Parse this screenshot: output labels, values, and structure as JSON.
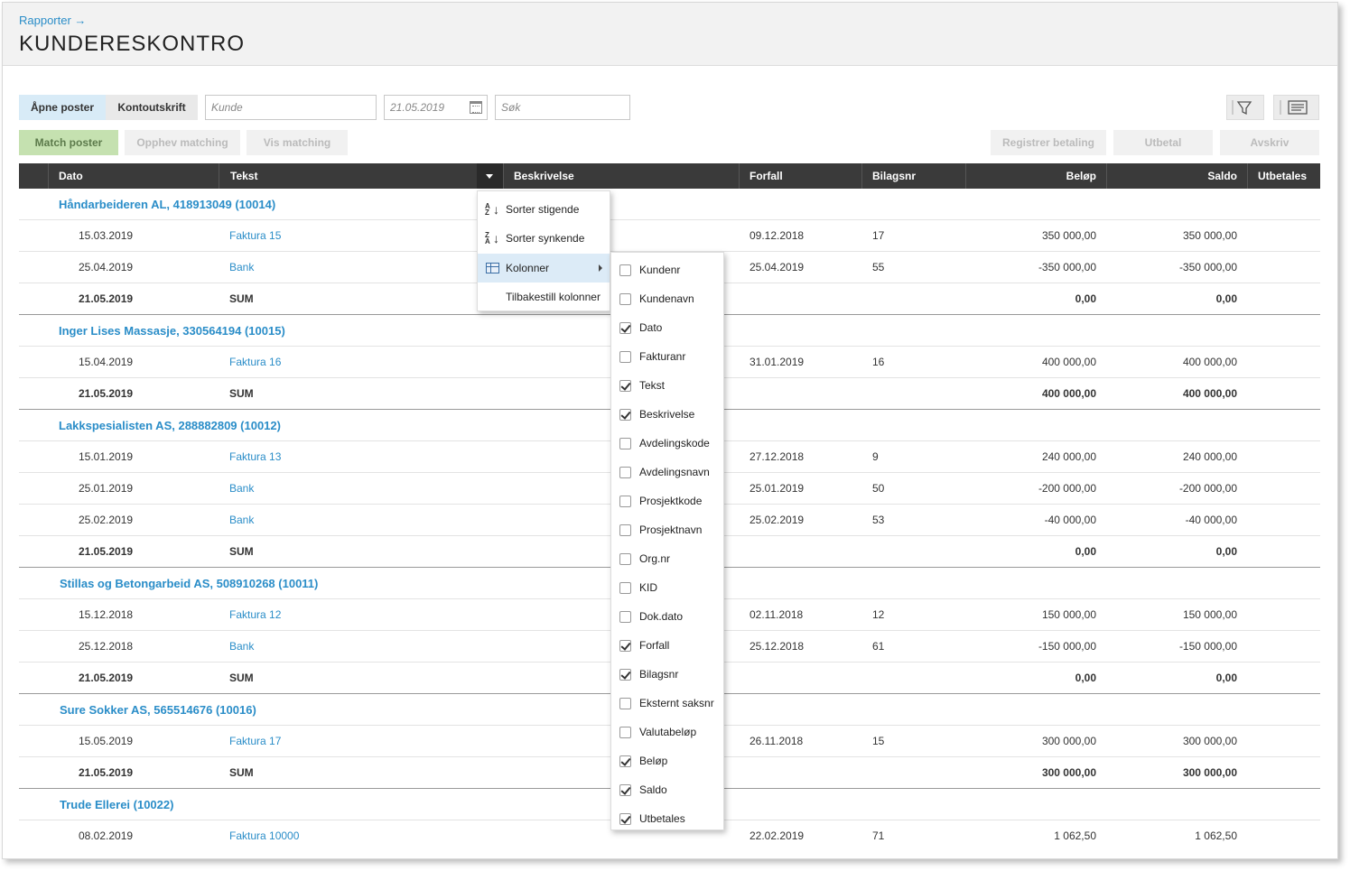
{
  "header": {
    "breadcrumb": "Rapporter →",
    "title": "KUNDERESKONTRO"
  },
  "toolbar": {
    "tab_open": "Åpne poster",
    "tab_statement": "Kontoutskrift",
    "customer_placeholder": "Kunde",
    "date_value": "21.05.2019",
    "search_placeholder": "Søk",
    "match_label": "Match poster",
    "unmatch_label": "Opphev matching",
    "show_matching_label": "Vis matching",
    "register_payment_label": "Registrer betaling",
    "payout_label": "Utbetal",
    "writeoff_label": "Avskriv"
  },
  "columns": {
    "dato": "Dato",
    "tekst": "Tekst",
    "beskrivelse": "Beskrivelse",
    "forfall": "Forfall",
    "bilagsnr": "Bilagsnr",
    "belop": "Beløp",
    "saldo": "Saldo",
    "utbetales": "Utbetales"
  },
  "groups": [
    {
      "title": "Håndarbeideren AL, 418913049 (10014)",
      "rows": [
        {
          "dato": "15.03.2019",
          "tekst": "Faktura 15",
          "forfall": "09.12.2018",
          "bilagsnr": "17",
          "belop": "350 000,00",
          "saldo": "350 000,00"
        },
        {
          "dato": "25.04.2019",
          "tekst": "Bank",
          "forfall": "25.04.2019",
          "bilagsnr": "55",
          "belop": "-350 000,00",
          "saldo": "-350 000,00"
        }
      ],
      "sum": {
        "dato": "21.05.2019",
        "tekst": "SUM",
        "belop": "0,00",
        "saldo": "0,00"
      }
    },
    {
      "title": "Inger Lises Massasje, 330564194 (10015)",
      "rows": [
        {
          "dato": "15.04.2019",
          "tekst": "Faktura 16",
          "forfall": "31.01.2019",
          "bilagsnr": "16",
          "belop": "400 000,00",
          "saldo": "400 000,00"
        }
      ],
      "sum": {
        "dato": "21.05.2019",
        "tekst": "SUM",
        "belop": "400 000,00",
        "saldo": "400 000,00"
      }
    },
    {
      "title": "Lakkspesialisten AS, 288882809 (10012)",
      "rows": [
        {
          "dato": "15.01.2019",
          "tekst": "Faktura 13",
          "forfall": "27.12.2018",
          "bilagsnr": "9",
          "belop": "240 000,00",
          "saldo": "240 000,00"
        },
        {
          "dato": "25.01.2019",
          "tekst": "Bank",
          "forfall": "25.01.2019",
          "bilagsnr": "50",
          "belop": "-200 000,00",
          "saldo": "-200 000,00"
        },
        {
          "dato": "25.02.2019",
          "tekst": "Bank",
          "forfall": "25.02.2019",
          "bilagsnr": "53",
          "belop": "-40 000,00",
          "saldo": "-40 000,00"
        }
      ],
      "sum": {
        "dato": "21.05.2019",
        "tekst": "SUM",
        "belop": "0,00",
        "saldo": "0,00"
      }
    },
    {
      "title": "Stillas og Betongarbeid AS, 508910268 (10011)",
      "rows": [
        {
          "dato": "15.12.2018",
          "tekst": "Faktura 12",
          "forfall": "02.11.2018",
          "bilagsnr": "12",
          "belop": "150 000,00",
          "saldo": "150 000,00"
        },
        {
          "dato": "25.12.2018",
          "tekst": "Bank",
          "forfall": "25.12.2018",
          "bilagsnr": "61",
          "belop": "-150 000,00",
          "saldo": "-150 000,00"
        }
      ],
      "sum": {
        "dato": "21.05.2019",
        "tekst": "SUM",
        "belop": "0,00",
        "saldo": "0,00"
      }
    },
    {
      "title": "Sure Sokker AS, 565514676 (10016)",
      "rows": [
        {
          "dato": "15.05.2019",
          "tekst": "Faktura 17",
          "forfall": "26.11.2018",
          "bilagsnr": "15",
          "belop": "300 000,00",
          "saldo": "300 000,00"
        }
      ],
      "sum": {
        "dato": "21.05.2019",
        "tekst": "SUM",
        "belop": "300 000,00",
        "saldo": "300 000,00"
      }
    },
    {
      "title": "Trude Ellerei (10022)",
      "rows": [
        {
          "dato": "08.02.2019",
          "tekst": "Faktura 10000",
          "forfall": "22.02.2019",
          "bilagsnr": "71",
          "belop": "1 062,50",
          "saldo": "1 062,50"
        }
      ]
    }
  ],
  "context_menu": {
    "sort_asc": "Sorter stigende",
    "sort_desc": "Sorter synkende",
    "columns": "Kolonner",
    "reset_columns": "Tilbakestill kolonner"
  },
  "column_options": [
    {
      "label": "Kundenr",
      "checked": false
    },
    {
      "label": "Kundenavn",
      "checked": false
    },
    {
      "label": "Dato",
      "checked": true
    },
    {
      "label": "Fakturanr",
      "checked": false
    },
    {
      "label": "Tekst",
      "checked": true
    },
    {
      "label": "Beskrivelse",
      "checked": true
    },
    {
      "label": "Avdelingskode",
      "checked": false
    },
    {
      "label": "Avdelingsnavn",
      "checked": false
    },
    {
      "label": "Prosjektkode",
      "checked": false
    },
    {
      "label": "Prosjektnavn",
      "checked": false
    },
    {
      "label": "Org.nr",
      "checked": false
    },
    {
      "label": "KID",
      "checked": false
    },
    {
      "label": "Dok.dato",
      "checked": false
    },
    {
      "label": "Forfall",
      "checked": true
    },
    {
      "label": "Bilagsnr",
      "checked": true
    },
    {
      "label": "Eksternt saksnr",
      "checked": false
    },
    {
      "label": "Valutabeløp",
      "checked": false
    },
    {
      "label": "Beløp",
      "checked": true
    },
    {
      "label": "Saldo",
      "checked": true
    },
    {
      "label": "Utbetales",
      "checked": true
    }
  ]
}
